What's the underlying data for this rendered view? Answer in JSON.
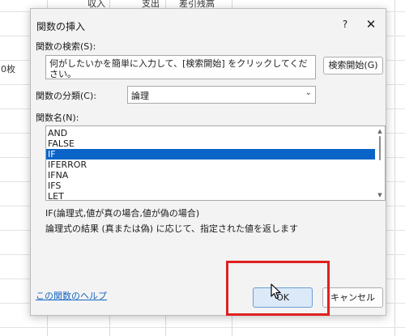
{
  "sheet": {
    "header_cells": [
      "収入",
      "支出",
      "差引残高"
    ],
    "side_text": "0枚"
  },
  "dialog": {
    "title": "関数の挿入",
    "help_glyph": "?",
    "close_glyph": "✕",
    "search_label": "関数の検索(S):",
    "search_value": "何がしたいかを簡単に入力して、[検索開始] をクリックしてください。",
    "search_button": "検索開始(G)",
    "category_label": "関数の分類(C):",
    "category_value": "論理",
    "function_list_label": "関数名(N):",
    "functions": [
      "AND",
      "FALSE",
      "IF",
      "IFERROR",
      "IFNA",
      "IFS",
      "LET"
    ],
    "selected_function": "IF",
    "syntax": "IF(論理式,値が真の場合,値が偽の場合)",
    "description": "論理式の結果 (真または偽) に応じて、指定された値を返します",
    "help_link": "この関数のヘルプ",
    "ok_button": "OK",
    "cancel_button": "キャンセル"
  },
  "colors": {
    "selection": "#0a64c8",
    "highlight_box": "#e02020",
    "link": "#1565c0"
  }
}
